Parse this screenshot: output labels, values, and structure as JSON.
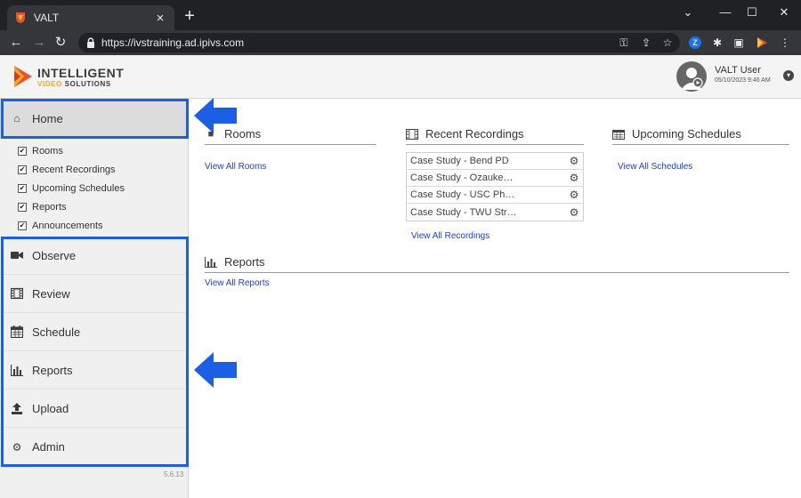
{
  "browser": {
    "tab_title": "VALT",
    "url": "https://ivstraining.ad.ipivs.com"
  },
  "header": {
    "logo_line1": "INTELLIGENT",
    "logo_line2_orange": "VIDEO",
    "logo_line2_rest": "SOLUTIONS",
    "user_name": "VALT User",
    "user_date": "05/10/2023 9:46 AM"
  },
  "sidebar": {
    "home_label": "Home",
    "subitems": [
      "Rooms",
      "Recent Recordings",
      "Upcoming Schedules",
      "Reports",
      "Announcements"
    ],
    "menu": [
      {
        "label": "Observe",
        "icon": "video-camera-icon"
      },
      {
        "label": "Review",
        "icon": "film-icon"
      },
      {
        "label": "Schedule",
        "icon": "calendar-icon"
      },
      {
        "label": "Reports",
        "icon": "bar-chart-icon"
      },
      {
        "label": "Upload",
        "icon": "upload-icon"
      },
      {
        "label": "Admin",
        "icon": "gear-icon"
      }
    ],
    "version": "5.6.13"
  },
  "main": {
    "rooms": {
      "title": "Rooms",
      "link": "View All Rooms"
    },
    "recordings": {
      "title": "Recent Recordings",
      "items": [
        "Case Study - Bend PD",
        "Case Study - Ozauke…",
        "Case Study - USC Ph…",
        "Case Study - TWU Str…"
      ],
      "link": "View All Recordings"
    },
    "schedules": {
      "title": "Upcoming Schedules",
      "link": "View All Schedules"
    },
    "reports": {
      "title": "Reports",
      "link": "View All Reports"
    }
  },
  "colors": {
    "highlight": "#1a5fe6",
    "link": "#1a3cf0",
    "brand_orange": "#f5a623"
  }
}
